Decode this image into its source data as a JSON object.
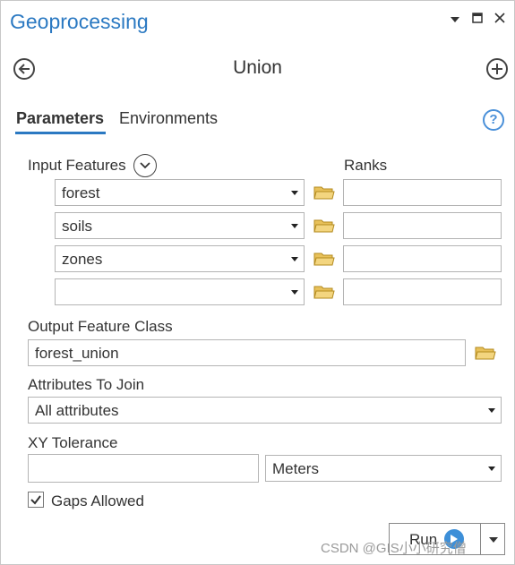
{
  "pane": {
    "title": "Geoprocessing",
    "window_controls": [
      "chevron-down-icon",
      "maximize-icon",
      "close-icon"
    ]
  },
  "tool": {
    "title": "Union",
    "back_icon": "back-arrow-icon",
    "add_icon": "add-icon"
  },
  "tabs": {
    "parameters": "Parameters",
    "environments": "Environments",
    "active": "Parameters"
  },
  "form": {
    "input_features_label": "Input Features",
    "ranks_label": "Ranks",
    "input_features": [
      {
        "value": "forest",
        "rank": ""
      },
      {
        "value": "soils",
        "rank": ""
      },
      {
        "value": "zones",
        "rank": ""
      },
      {
        "value": "",
        "rank": ""
      }
    ],
    "output_label": "Output Feature Class",
    "output_value": "forest_union",
    "attributes_label": "Attributes To Join",
    "attributes_value": "All attributes",
    "xy_label": "XY Tolerance",
    "xy_value": "",
    "xy_unit": "Meters",
    "gaps_label": "Gaps Allowed",
    "gaps_checked": true
  },
  "run": {
    "label": "Run"
  },
  "watermark": "CSDN @GIS小小研究僧",
  "colors": {
    "accent": "#2b79c2",
    "folder": "#e8c15a",
    "run_icon": "#3d8fd8"
  }
}
